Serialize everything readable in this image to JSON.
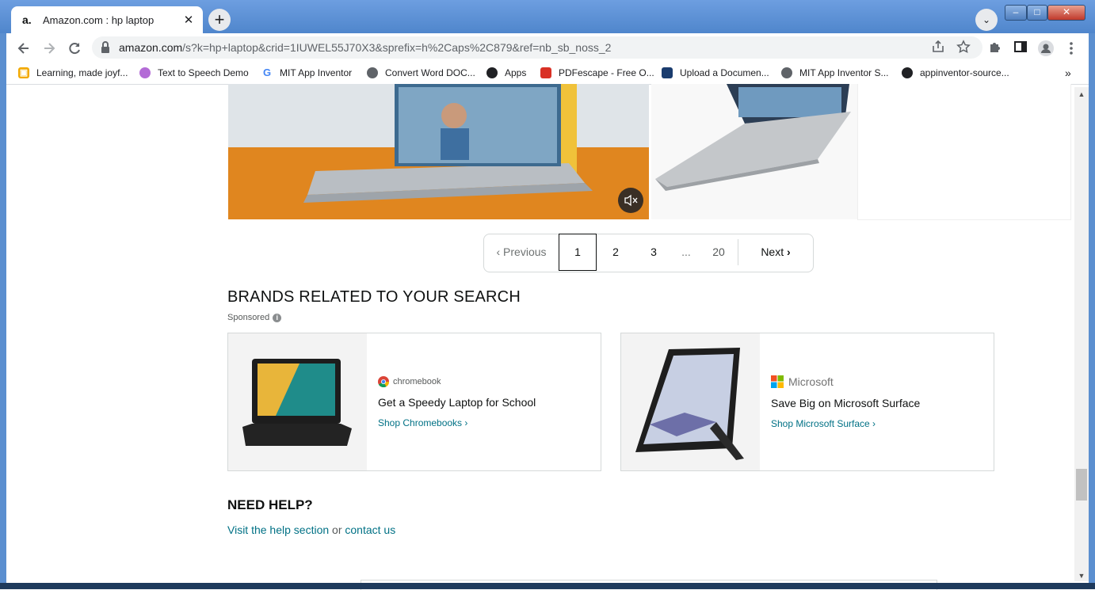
{
  "browser": {
    "tab_title": "Amazon.com : hp laptop",
    "tab_favicon": "a.",
    "tab_close": "✕",
    "new_tab": "+",
    "tab_search": "⌄",
    "url_host": "amazon.com",
    "url_path": "/s?k=hp+laptop&crid=1IUWEL55J70X3&sprefix=h%2Caps%2C879&ref=nb_sb_noss_2",
    "window_min": "–",
    "window_max": "□",
    "window_close": "✕"
  },
  "bookmarks": [
    {
      "label": "Learning, made joyf...",
      "icon": "learning-icon",
      "color": "#f2a900"
    },
    {
      "label": "Text to Speech Demo",
      "icon": "speech-icon",
      "color": "#b36bd6"
    },
    {
      "label": "MIT App Inventor",
      "icon": "google-icon",
      "color": "#4285f4"
    },
    {
      "label": "Convert Word DOC...",
      "icon": "globe-icon",
      "color": "#5f6368"
    },
    {
      "label": "Apps",
      "icon": "apps-icon",
      "color": "#202124"
    },
    {
      "label": "PDFescape - Free O...",
      "icon": "pdf-icon",
      "color": "#d93025"
    },
    {
      "label": "Upload a Documen...",
      "icon": "upload-icon",
      "color": "#1a3c6e"
    },
    {
      "label": "MIT App Inventor S...",
      "icon": "globe-icon",
      "color": "#5f6368"
    },
    {
      "label": "appinventor-source...",
      "icon": "github-icon",
      "color": "#202124"
    }
  ],
  "bookmarks_more": "»",
  "pagination": {
    "previous": "Previous",
    "pages": [
      "1",
      "2",
      "3",
      "...",
      "20"
    ],
    "current": "1",
    "next": "Next"
  },
  "brands": {
    "heading": "BRANDS RELATED TO YOUR SEARCH",
    "sponsored": "Sponsored",
    "cards": [
      {
        "logo": "chromebook",
        "title": "Get a Speedy Laptop for School",
        "link": "Shop Chromebooks ›"
      },
      {
        "logo": "Microsoft",
        "title": "Save Big on Microsoft Surface",
        "link": "Shop Microsoft Surface ›"
      }
    ]
  },
  "help": {
    "heading": "NEED HELP?",
    "prefix": "Visit the help section",
    "middle": " or ",
    "link": "contact us"
  },
  "colors": {
    "link": "#007185",
    "chrome_frame": "#5b8fd0"
  }
}
